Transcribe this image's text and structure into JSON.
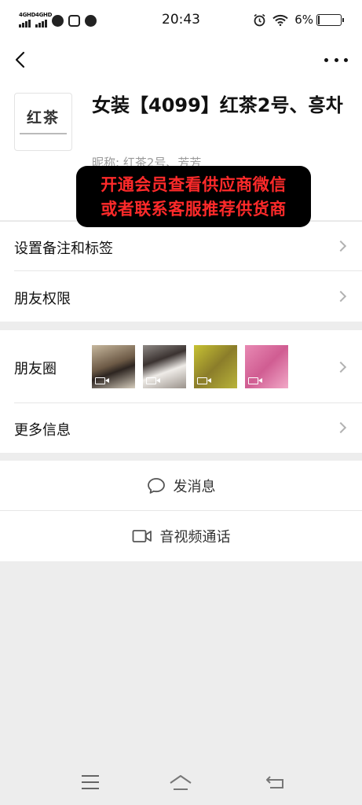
{
  "status_bar": {
    "signal_1": "4GHD",
    "signal_2": "4GHD",
    "time": "20:43",
    "battery_text": "6%",
    "battery_level": 0.06
  },
  "profile": {
    "avatar_text": "红茶",
    "name": "女装【4099】红茶2号、흥차",
    "nickname_label": "昵称:",
    "nickname": "红茶2号、芳芳"
  },
  "banner": {
    "line1": "开通会员查看供应商微信",
    "line2": "或者联系客服推荐供货商"
  },
  "menu": {
    "remark_label": "设置备注和标签",
    "permissions_label": "朋友权限",
    "moments_label": "朋友圈",
    "more_info_label": "更多信息"
  },
  "actions": {
    "message_label": "发消息",
    "call_label": "音视频通话"
  },
  "colors": {
    "banner_bg": "#000000",
    "banner_text": "#ff2a2a",
    "background": "#ededed"
  }
}
